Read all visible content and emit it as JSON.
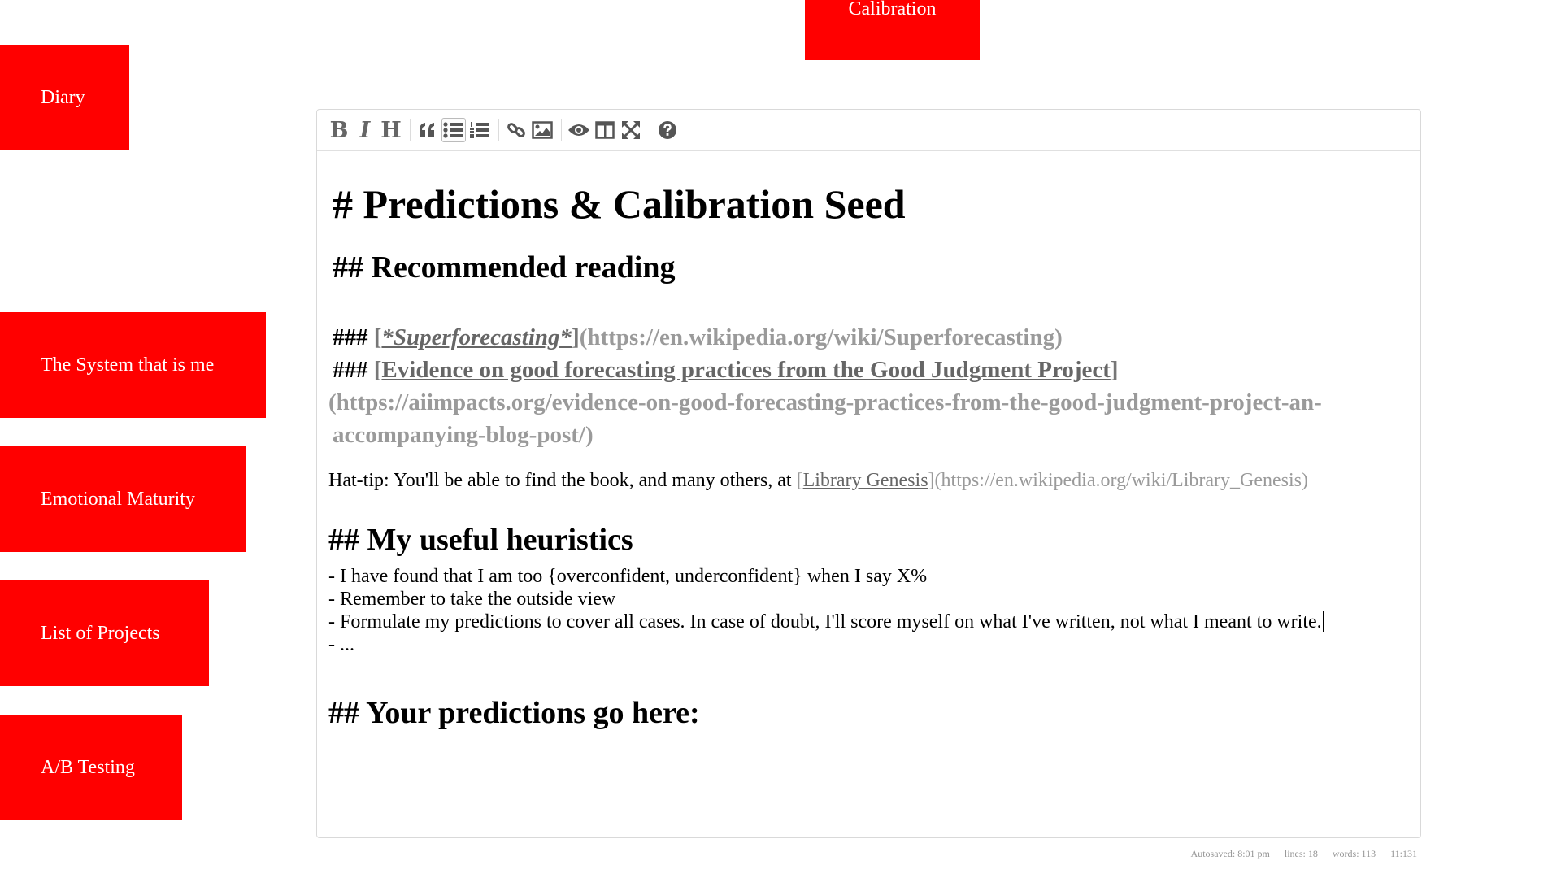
{
  "top_tab": {
    "label": "Calibration"
  },
  "nav": [
    {
      "label": "Diary"
    },
    {
      "label": "The System that is me"
    },
    {
      "label": "Emotional Maturity"
    },
    {
      "label": "List of Projects"
    },
    {
      "label": "A/B Testing"
    }
  ],
  "toolbar": {
    "bold_glyph": "B",
    "italic_glyph": "I",
    "heading_glyph": "H",
    "icons": [
      "bold-icon",
      "italic-icon",
      "heading-icon",
      "quote-icon",
      "unordered-list-icon",
      "ordered-list-icon",
      "link-icon",
      "image-icon",
      "preview-icon",
      "side-by-side-icon",
      "fullscreen-icon",
      "help-icon"
    ]
  },
  "doc": {
    "h1": "# Predictions & Calibration Seed",
    "h2_reading": "## Recommended reading",
    "ref1": {
      "mark": "### ",
      "open": "[",
      "text": "*Superforecasting*",
      "close": "]",
      "url": "(https://en.wikipedia.org/wiki/Superforecasting)"
    },
    "ref2": {
      "mark": "### ",
      "open": "[",
      "text": "Evidence on good forecasting practices from the Good Judgment Project",
      "close": "]",
      "url": "(https://aiimpacts.org/evidence-on-good-forecasting-practices-from-the-good-judgment-project-an-accompanying-blog-post/)"
    },
    "hattip": {
      "prefix": "Hat-tip: You'll be able to find the book, and many others, at ",
      "open": "[",
      "text": "Library Genesis",
      "close": "]",
      "url": "(https://en.wikipedia.org/wiki/Library_Genesis)"
    },
    "h2_heuristics": "## My useful heuristics",
    "heuristics": [
      "- I have found that I am too {overconfident, underconfident} when I say X%",
      "- Remember to take the outside view",
      "- Formulate my predictions to cover all cases. In case of doubt, I'll score myself on what I've written, not what I meant to write.",
      "- ..."
    ],
    "h2_predictions": "## Your predictions go here:"
  },
  "status": {
    "autosaved": "Autosaved: 8:01 pm",
    "lines": "lines: 18",
    "words": "words: 113",
    "cursor": "11:131"
  }
}
